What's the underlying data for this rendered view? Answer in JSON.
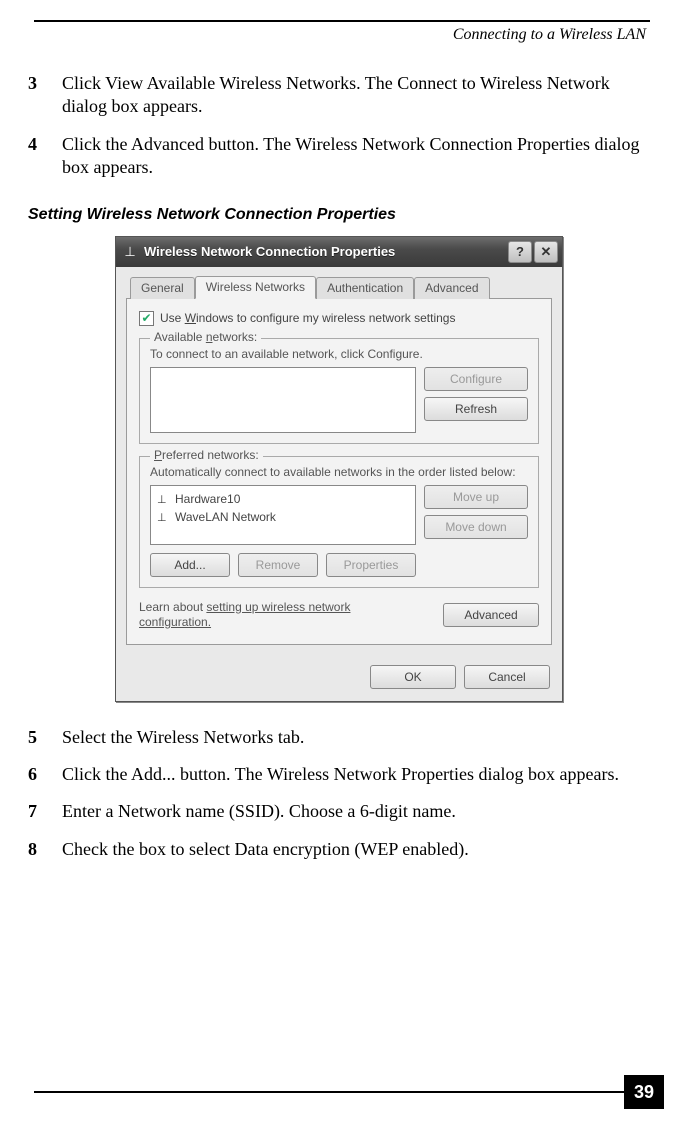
{
  "runningHead": "Connecting to a Wireless LAN",
  "stepsTop": [
    {
      "n": "3",
      "t": "Click View Available Wireless Networks. The Connect to Wireless Network dialog box appears."
    },
    {
      "n": "4",
      "t": "Click the Advanced button. The Wireless Network Connection Properties dialog box appears."
    }
  ],
  "captionTitle": "Setting Wireless Network Connection Properties",
  "dialog": {
    "title": "Wireless Network Connection Properties",
    "helpGlyph": "?",
    "closeGlyph": "✕",
    "tabs": {
      "general": "General",
      "wireless": "Wireless Networks",
      "auth": "Authentication",
      "advanced": "Advanced"
    },
    "checkbox": {
      "checked": true,
      "pre": "Use ",
      "u": "W",
      "post": "indows to configure my wireless network settings"
    },
    "available": {
      "legendPre": "Available ",
      "legendU": "n",
      "legendPost": "etworks:",
      "desc": "To connect to an available network, click Configure.",
      "configure": "Configure",
      "refresh": "Refresh"
    },
    "preferred": {
      "legendPre": "",
      "legendU": "P",
      "legendPost": "referred networks:",
      "desc": "Automatically connect to available networks in the order listed below:",
      "items": [
        "Hardware10",
        "WaveLAN Network"
      ],
      "moveUp": "Move up",
      "moveDown": "Move down",
      "add": "Add...",
      "remove": "Remove",
      "properties": "Properties"
    },
    "learn": {
      "pre": "Learn about ",
      "link": "setting up wireless network configuration.",
      "advanced": "Advanced"
    },
    "ok": "OK",
    "cancel": "Cancel"
  },
  "stepsBottom": [
    {
      "n": "5",
      "t": "Select the Wireless Networks tab."
    },
    {
      "n": "6",
      "t": "Click the Add... button. The Wireless Network Properties dialog box appears."
    },
    {
      "n": "7",
      "t": "Enter a Network name (SSID). Choose a 6-digit name."
    },
    {
      "n": "8",
      "t": "Check the box to select Data encryption (WEP enabled)."
    }
  ],
  "pageNumber": "39"
}
